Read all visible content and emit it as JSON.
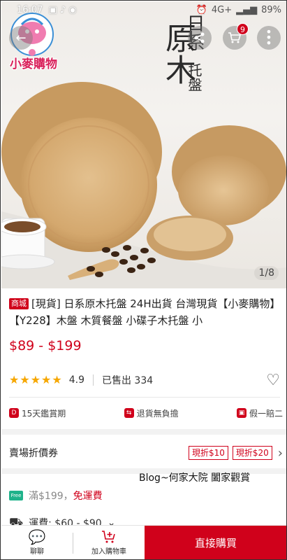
{
  "status_bar": {
    "time": "16:07",
    "battery": "89%",
    "signal": "4G+"
  },
  "logo": {
    "text": "小麥購物"
  },
  "hero": {
    "title_chars_1": "日系",
    "title_chars_2": "原木",
    "title_chars_3": "托盤",
    "pager": "1/8"
  },
  "header": {
    "cart_count": "9"
  },
  "product": {
    "mall_badge": "商城",
    "title": "[現貨] 日系原木托盤 24H出貨 台灣現貨【小麥購物】【Y228】木盤 木質餐盤 小碟子木托盤 小",
    "price": "$89 - $199",
    "rating": "4.9",
    "rating_value": 4.9,
    "sold": "已售出 334"
  },
  "guarantees": [
    {
      "label": "15天鑑賞期"
    },
    {
      "label": "退貨無負擔"
    },
    {
      "label": "假一賠二"
    }
  ],
  "vouchers": {
    "label": "賣場折價券",
    "items": [
      "現折$10",
      "現折$20"
    ]
  },
  "watermark": "Blog~何家大院 闔家觀賞",
  "shipping": {
    "threshold": "滿$199，",
    "free_text": "免運費",
    "free_icon": "Free",
    "fee": "運費: $60 - $90"
  },
  "bottom_bar": {
    "chat_label": "聊聊",
    "cart_label": "加入購物車",
    "buy_label": "直接購買"
  },
  "colors": {
    "accent": "#d0011b",
    "star": "#f6a700"
  }
}
